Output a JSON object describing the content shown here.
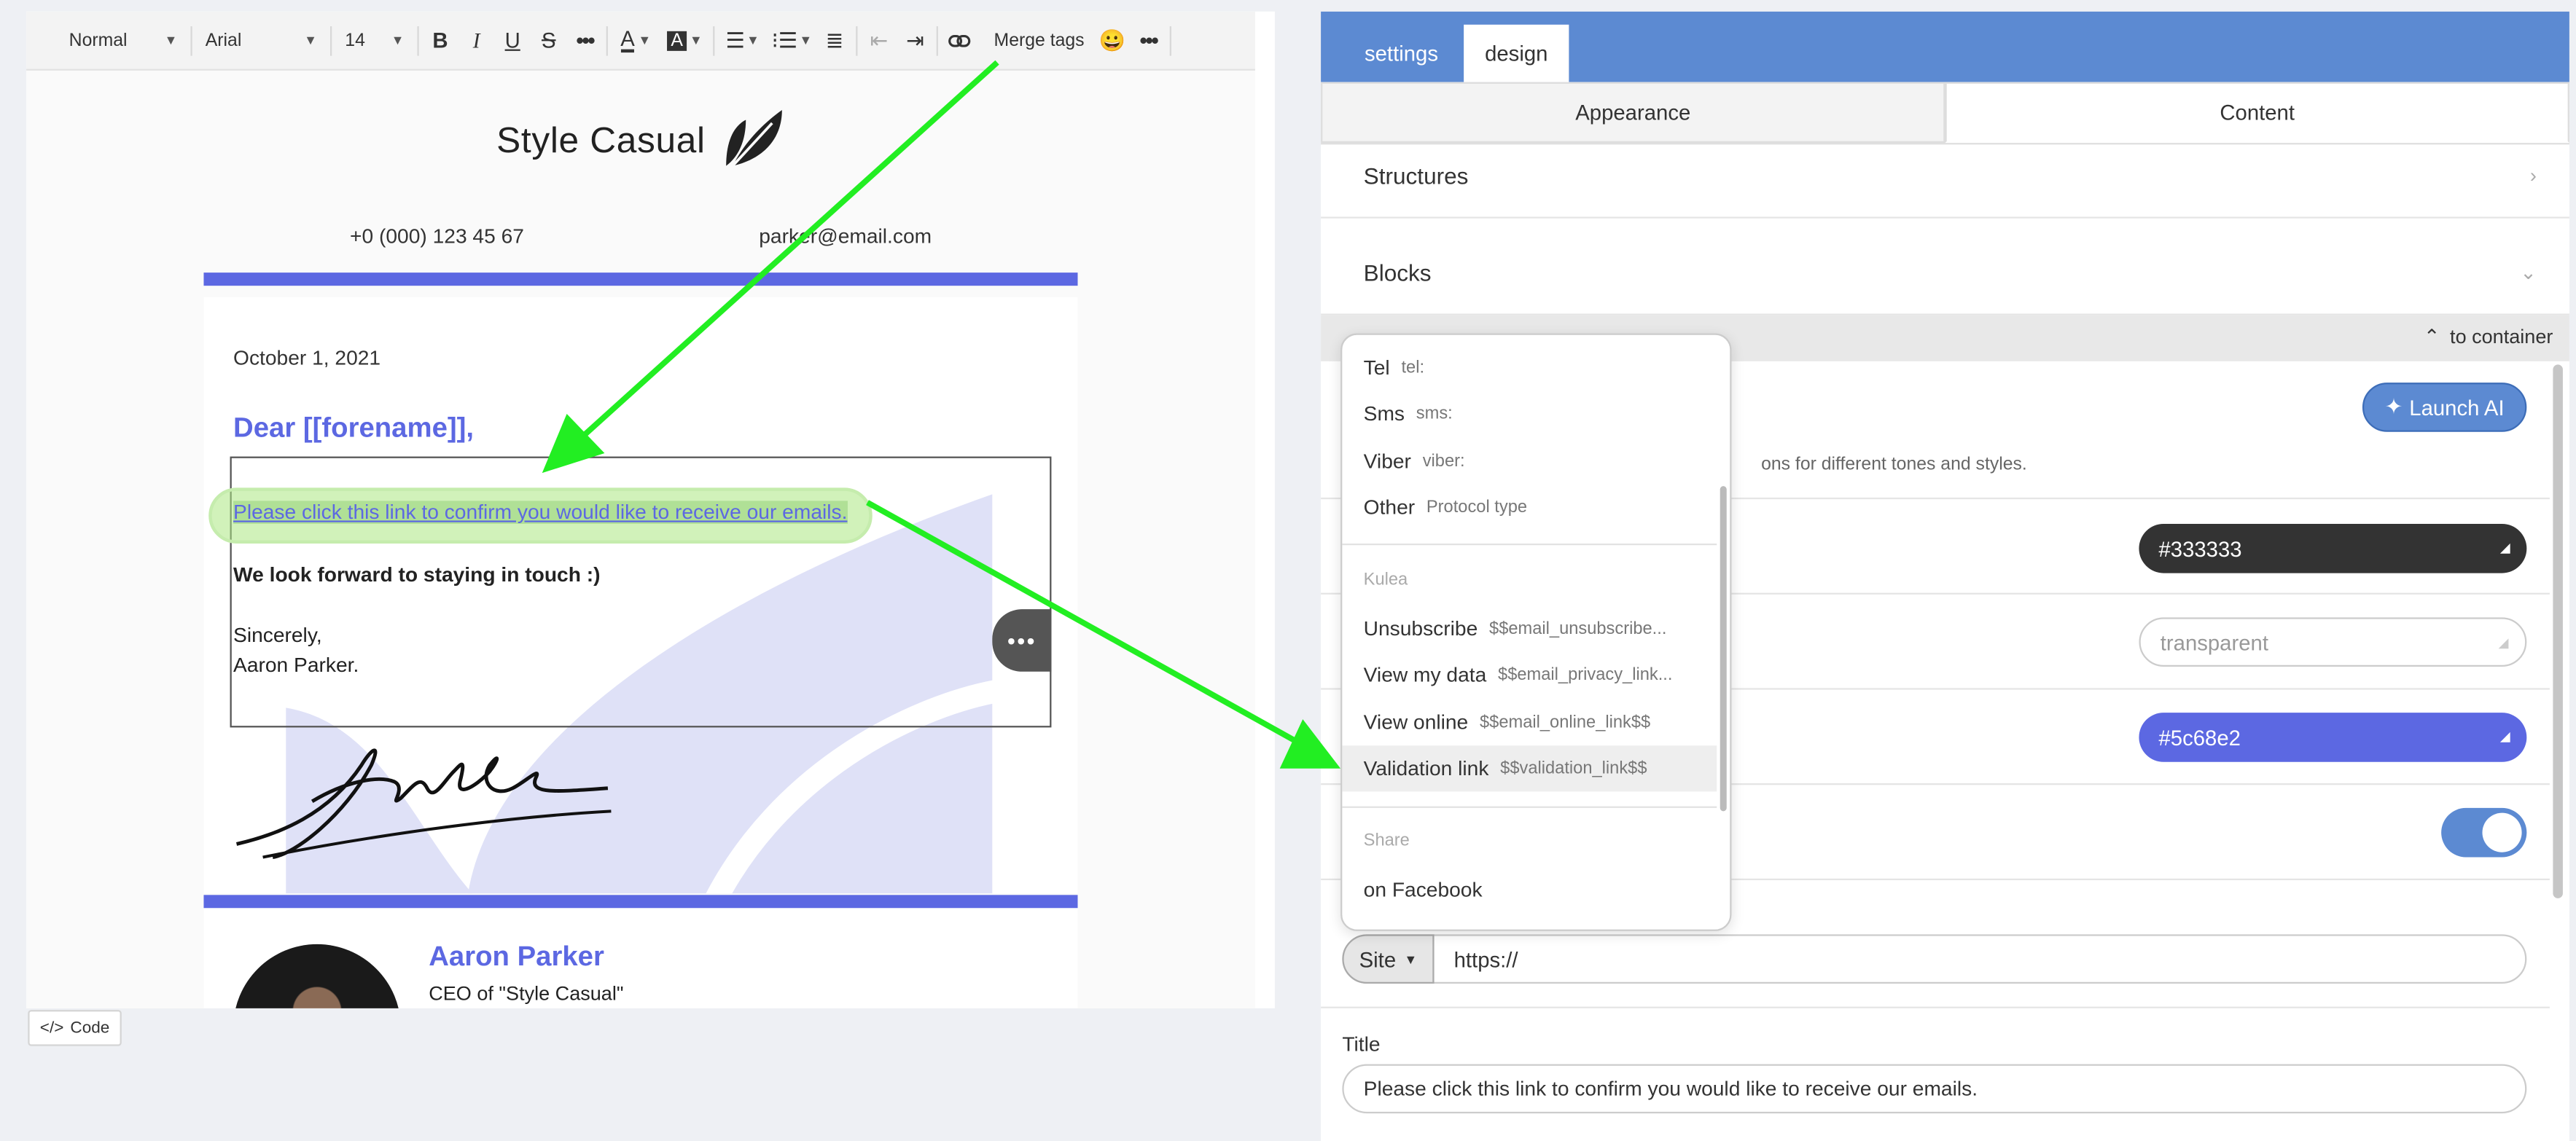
{
  "toolbar": {
    "paragraph_style": "Normal",
    "font_family": "Arial",
    "font_size": "14",
    "merge_tags_label": "Merge tags",
    "emoji": "😀"
  },
  "email": {
    "brand": "Style Casual",
    "phone": "+0 (000) 123 45 67",
    "email": "parker@email.com",
    "date": "October 1, 2021",
    "greeting": "Dear [[forename]],",
    "link_text": "Please click this link to confirm you would like to receive our emails.",
    "forward": "We look forward to staying in touch :)",
    "sincerely": "Sincerely,",
    "signoff_name": "Aaron Parker.",
    "signature_name": "Aaron Parker",
    "signature_title": "CEO of \"Style Casual\"",
    "accent_color": "#5c68e2"
  },
  "code_button": "Code",
  "panel": {
    "tabs": [
      {
        "label": "settings",
        "active": false
      },
      {
        "label": "design",
        "active": true
      }
    ],
    "subtabs": [
      {
        "label": "Appearance",
        "active": false
      },
      {
        "label": "Content",
        "active": true
      }
    ],
    "sections": {
      "structures": "Structures",
      "blocks": "Blocks"
    },
    "to_container": "to container",
    "launch_ai": "Launch AI",
    "ai_hint": "ons for different tones and styles.",
    "text_color": "#333333",
    "background_color": "transparent",
    "link_color": "#5c68e2",
    "toggle_on": true,
    "link_type": "Site",
    "url_value": "https://",
    "title_label": "Title",
    "title_value": "Please click this link to confirm you would like to receive our emails."
  },
  "dropdown": {
    "protocols": [
      {
        "label": "Tel",
        "value": "tel:"
      },
      {
        "label": "Sms",
        "value": "sms:"
      },
      {
        "label": "Viber",
        "value": "viber:"
      },
      {
        "label": "Other",
        "value": "Protocol type"
      }
    ],
    "kulea_group": "Kulea",
    "kulea": [
      {
        "label": "Unsubscribe",
        "value": "$$email_unsubscribe..."
      },
      {
        "label": "View my data",
        "value": "$$email_privacy_link..."
      },
      {
        "label": "View online",
        "value": "$$email_online_link$$"
      },
      {
        "label": "Validation link",
        "value": "$$validation_link$$"
      }
    ],
    "share_group": "Share",
    "share": [
      {
        "label": "on Facebook"
      }
    ],
    "hovered": "Validation link"
  },
  "annotation_color": "#22ee22"
}
